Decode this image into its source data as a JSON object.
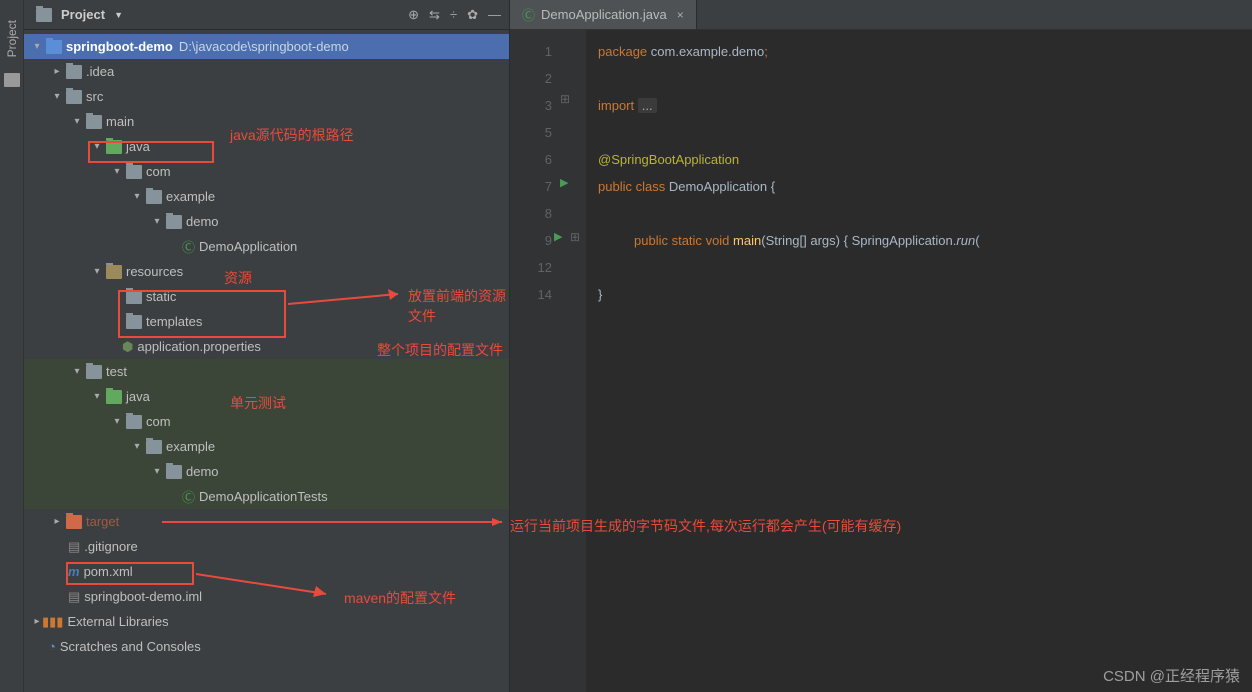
{
  "rail": {
    "label": "Project"
  },
  "panel": {
    "title": "Project"
  },
  "projectRoot": {
    "name": "springboot-demo",
    "path": "D:\\javacode\\springboot-demo"
  },
  "tree": {
    "idea": ".idea",
    "src": "src",
    "main": "main",
    "java": "java",
    "com": "com",
    "example": "example",
    "demo": "demo",
    "demoApp": "DemoApplication",
    "resources": "resources",
    "static": "static",
    "templates": "templates",
    "appProps": "application.properties",
    "test": "test",
    "testJava": "java",
    "testCom": "com",
    "testExample": "example",
    "testDemo": "demo",
    "demoAppTests": "DemoApplicationTests",
    "target": "target",
    "gitignore": ".gitignore",
    "pom": "pom.xml",
    "iml": "springboot-demo.iml",
    "extLib": "External Libraries",
    "scratches": "Scratches and Consoles"
  },
  "annotations": {
    "javaRoot": "java源代码的根路径",
    "resources": "资源",
    "frontend": "放置前端的资源文件",
    "config": "整个项目的配置文件",
    "unitTest": "单元测试",
    "target": "运行当前项目生成的字节码文件,每次运行都会产生(可能有缓存)",
    "maven": "maven的配置文件"
  },
  "tab": {
    "label": "DemoApplication.java"
  },
  "lineNumbers": [
    "1",
    "2",
    "3",
    "5",
    "6",
    "7",
    "8",
    "9",
    "12",
    "",
    "14"
  ],
  "code": {
    "package": "package",
    "pkgName": "com.example.demo",
    "import": "import",
    "ellipsis": "...",
    "anno": "@SpringBootApplication",
    "public": "public",
    "class": "class",
    "className": "DemoApplication",
    "static": "static",
    "void": "void",
    "main": "main",
    "params": "(String[] args)",
    "springApp": "SpringApplication",
    "run": "run"
  },
  "watermark": "CSDN @正经程序猿"
}
